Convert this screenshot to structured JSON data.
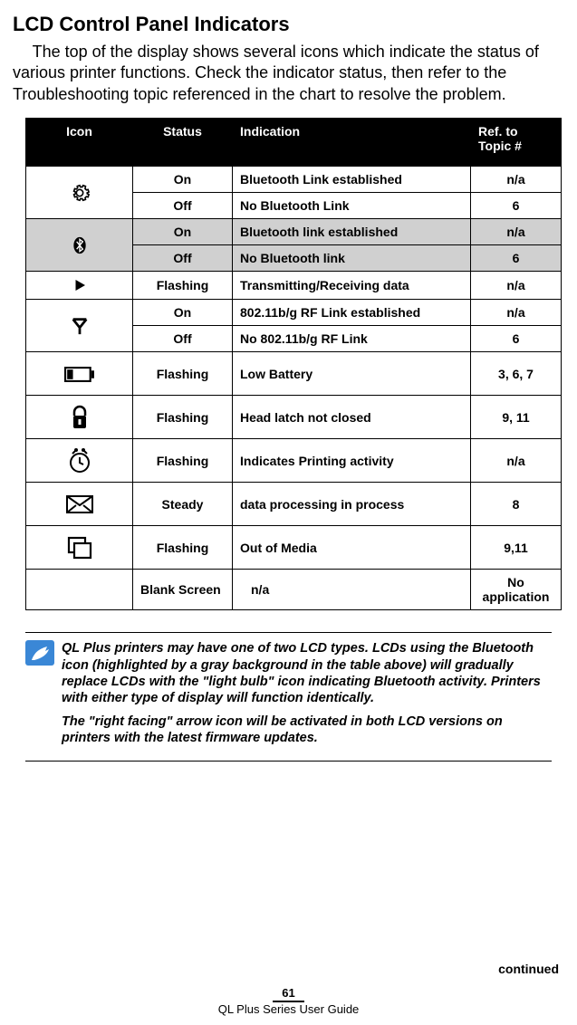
{
  "title": "LCD Control Panel Indicators",
  "intro": "The top of the display shows several icons which indicate the status of various printer functions. Check the indicator status, then refer to the Troubleshooting topic referenced in the chart to resolve the problem.",
  "headers": {
    "icon": "Icon",
    "status": "Status",
    "indication": "Indication",
    "ref": "Ref. to Topic #"
  },
  "rows": [
    {
      "iconRowspan": 2,
      "icon": "gear",
      "status": "On",
      "indication": "Bluetooth Link established",
      "ref": "n/a"
    },
    {
      "status": "Off",
      "indication": "No Bluetooth Link",
      "ref": "6"
    },
    {
      "iconRowspan": 2,
      "icon": "bt",
      "gray": true,
      "status": "On",
      "indication": "Bluetooth link established",
      "ref": "n/a"
    },
    {
      "gray": true,
      "status": "Off",
      "indication": "No Bluetooth link",
      "ref": "6"
    },
    {
      "iconRowspan": 1,
      "icon": "play",
      "status": "Flashing",
      "indication": "Transmitting/Receiving data",
      "ref": "n/a"
    },
    {
      "iconRowspan": 2,
      "icon": "ant",
      "status": "On",
      "indication": "802.11b/g RF Link established",
      "ref": "n/a"
    },
    {
      "status": "Off",
      "indication": "No 802.11b/g RF Link",
      "ref": "6"
    },
    {
      "iconRowspan": 1,
      "icon": "batt",
      "tall": true,
      "status": "Flashing",
      "indication": "Low Battery",
      "ref": "3, 6, 7"
    },
    {
      "iconRowspan": 1,
      "icon": "latch",
      "tall": true,
      "status": "Flashing",
      "indication": "Head latch not closed",
      "ref": "9, 11"
    },
    {
      "iconRowspan": 1,
      "icon": "clock",
      "tall": true,
      "status": "Flashing",
      "indication": "Indicates Printing activity",
      "ref": "n/a"
    },
    {
      "iconRowspan": 1,
      "icon": "envelope",
      "tall": true,
      "status": "Steady",
      "indication": "data processing in process",
      "ref": "8"
    },
    {
      "iconRowspan": 1,
      "icon": "media",
      "tall": true,
      "status": "Flashing",
      "indication": "Out of Media",
      "ref": "9,11"
    },
    {
      "iconRowspan": 1,
      "icon": "",
      "status": "Blank Screen",
      "indication": "n/a",
      "ref": "No application"
    }
  ],
  "note1": "QL Plus printers may have one of two LCD types.  LCDs using the Bluetooth icon (highlighted  by a gray background in the table above) will gradually replace LCDs with the \"light bulb\" icon indicating Bluetooth activity.  Printers with either type of display will function identically.",
  "note2": "The \"right facing\" arrow icon will be activated in both LCD versions on printers with the latest firmware updates.",
  "continued": "continued",
  "pageNumber": "61",
  "guideName": "QL Plus Series User Guide"
}
